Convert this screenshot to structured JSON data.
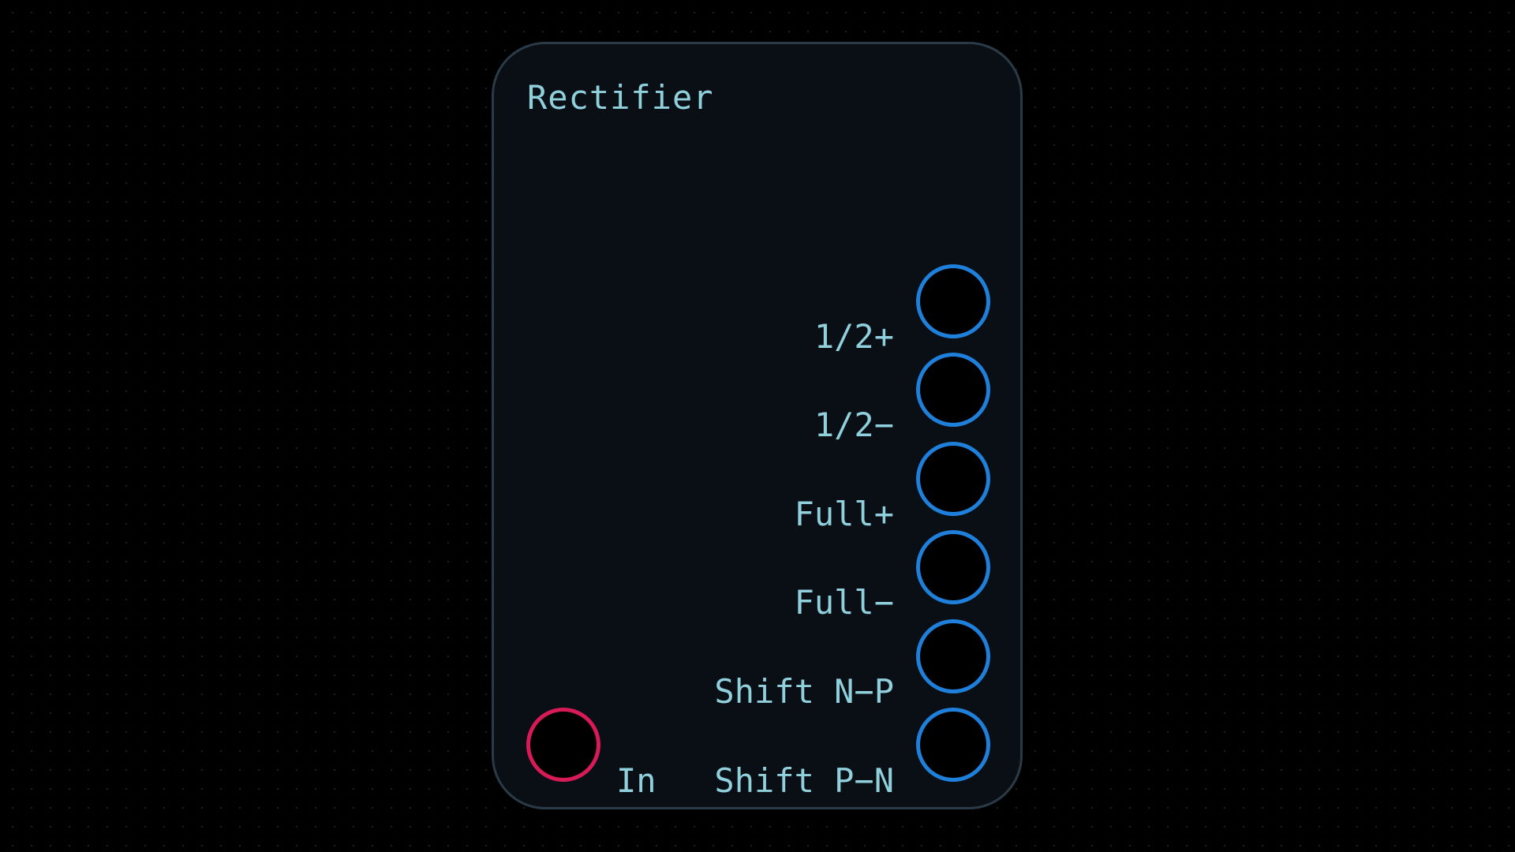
{
  "module": {
    "title": "Rectifier",
    "outputs": [
      {
        "label": "1/2+"
      },
      {
        "label": "1/2−"
      },
      {
        "label": "Full+"
      },
      {
        "label": "Full−"
      },
      {
        "label": "Shift N−P"
      },
      {
        "label": "Shift P−N"
      }
    ],
    "inputs": [
      {
        "label": "In"
      }
    ]
  },
  "colors": {
    "background": "#000000",
    "panel": "#0a0f15",
    "panel_border": "#2a3a47",
    "text": "#8fd0dc",
    "output_port": "#1f80db",
    "input_port": "#d81a57"
  }
}
